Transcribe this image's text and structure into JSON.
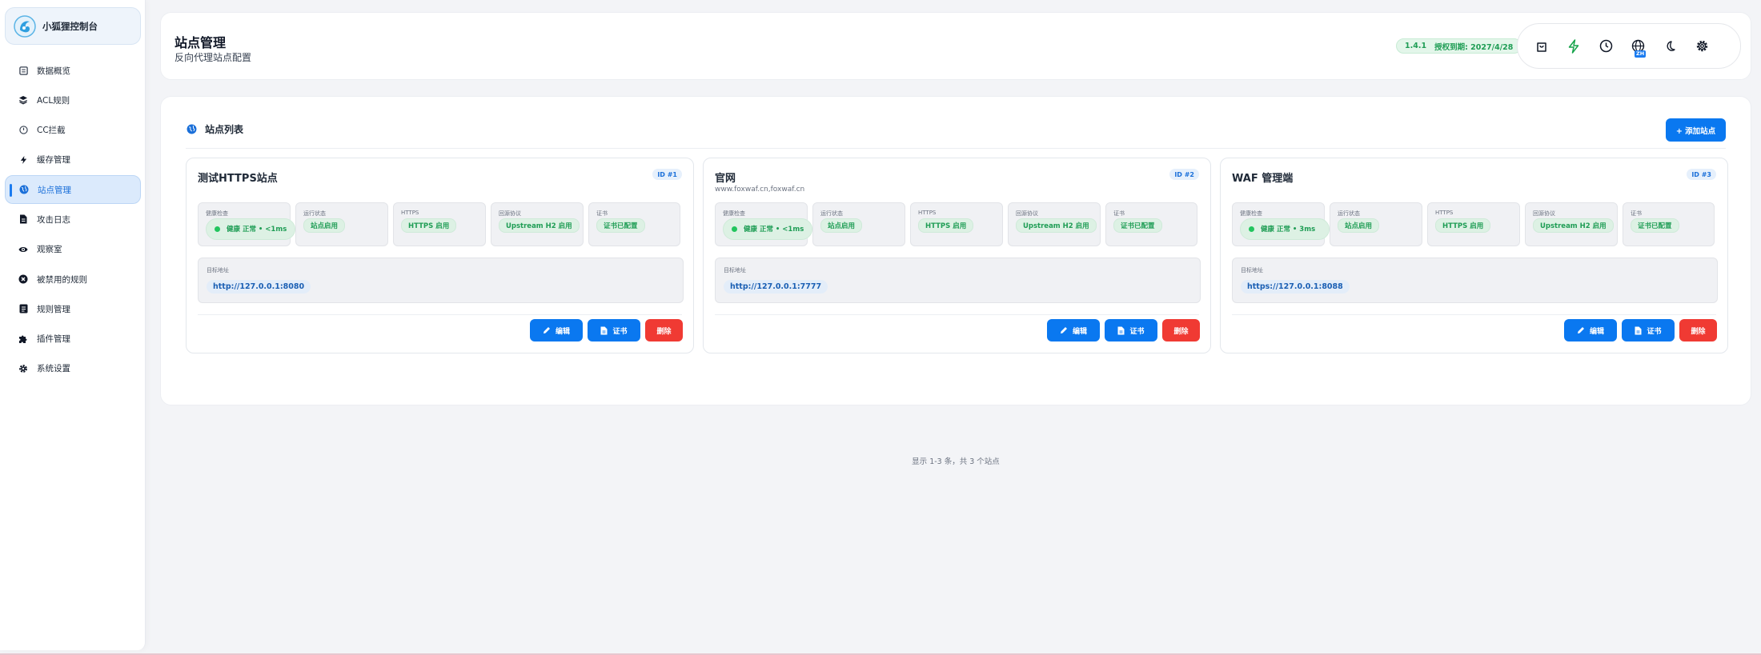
{
  "sidebar": {
    "brand": "小狐狸控制台",
    "items": [
      {
        "label": "数据概览",
        "icon": "dashboard-icon"
      },
      {
        "label": "ACL规则",
        "icon": "layers-icon"
      },
      {
        "label": "CC拦截",
        "icon": "clock-icon"
      },
      {
        "label": "缓存管理",
        "icon": "bolt-icon"
      },
      {
        "label": "站点管理",
        "icon": "globe-icon",
        "active": true
      },
      {
        "label": "攻击日志",
        "icon": "file-icon"
      },
      {
        "label": "观察室",
        "icon": "eye-icon"
      },
      {
        "label": "被禁用的规则",
        "icon": "x-circle-icon"
      },
      {
        "label": "规则管理",
        "icon": "list-icon"
      },
      {
        "label": "插件管理",
        "icon": "puzzle-icon"
      },
      {
        "label": "系统设置",
        "icon": "gear-icon"
      }
    ]
  },
  "header": {
    "title": "站点管理",
    "subtitle": "反向代理站点配置",
    "version": "1.4.1",
    "license": "授权到期: 2027/4/28",
    "lang_badge": "ZH"
  },
  "panel": {
    "title": "站点列表",
    "add_button": "+ 添加站点",
    "footer": "显示 1-3 条，共 3 个站点"
  },
  "labels": {
    "health": "健康检查",
    "status": "运行状态",
    "https": "HTTPS",
    "upstream": "回源协议",
    "cert": "证书",
    "target": "目标地址",
    "edit": "编辑",
    "certbtn": "证书",
    "delete": "删除"
  },
  "sites": [
    {
      "name": "测试HTTPS站点",
      "domain": "",
      "id": "ID #1",
      "health": "健康 正常 • <1ms",
      "status": "站点启用",
      "https": "HTTPS 启用",
      "upstream": "Upstream H2 启用",
      "cert": "证书已配置",
      "target": "http://127.0.0.1:8080"
    },
    {
      "name": "官网",
      "domain": "www.foxwaf.cn,foxwaf.cn",
      "id": "ID #2",
      "health": "健康 正常 • <1ms",
      "status": "站点启用",
      "https": "HTTPS 启用",
      "upstream": "Upstream H2 启用",
      "cert": "证书已配置",
      "target": "http://127.0.0.1:7777"
    },
    {
      "name": "WAF 管理端",
      "domain": "",
      "id": "ID #3",
      "health": "健康 正常 • 3ms",
      "status": "站点启用",
      "https": "HTTPS 启用",
      "upstream": "Upstream H2 启用",
      "cert": "证书已配置",
      "target": "https://127.0.0.1:8088"
    }
  ],
  "colors": {
    "accent": "#0a78f0",
    "success": "#1f9d55",
    "danger": "#f03a33"
  }
}
